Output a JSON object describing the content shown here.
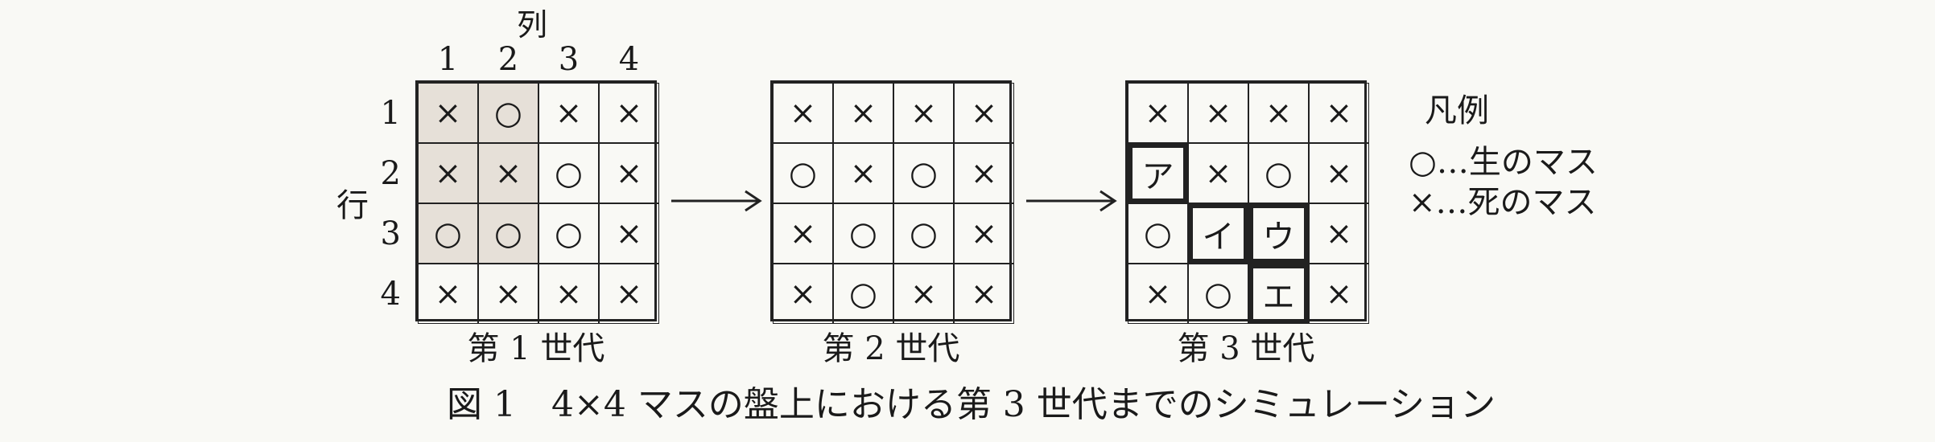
{
  "header": {
    "col_label": "列",
    "col_numbers": [
      "1",
      "2",
      "3",
      "4"
    ],
    "row_label": "行",
    "row_numbers": [
      "1",
      "2",
      "3",
      "4"
    ]
  },
  "generations": [
    {
      "caption": "第 1 世代",
      "cells": [
        [
          "×",
          "○",
          "×",
          "×"
        ],
        [
          "×",
          "×",
          "○",
          "×"
        ],
        [
          "○",
          "○",
          "○",
          "×"
        ],
        [
          "×",
          "×",
          "×",
          "×"
        ]
      ],
      "shaded": [
        [
          0,
          0
        ],
        [
          0,
          1
        ],
        [
          1,
          0
        ],
        [
          1,
          1
        ],
        [
          2,
          0
        ],
        [
          2,
          1
        ]
      ]
    },
    {
      "caption": "第 2 世代",
      "cells": [
        [
          "×",
          "×",
          "×",
          "×"
        ],
        [
          "○",
          "×",
          "○",
          "×"
        ],
        [
          "×",
          "○",
          "○",
          "×"
        ],
        [
          "×",
          "○",
          "×",
          "×"
        ]
      ]
    },
    {
      "caption": "第 3 世代",
      "cells": [
        [
          "×",
          "×",
          "×",
          "×"
        ],
        [
          "ア",
          "×",
          "○",
          "×"
        ],
        [
          "○",
          "イ",
          "ウ",
          "×"
        ],
        [
          "×",
          "○",
          "エ",
          "×"
        ]
      ],
      "bold": [
        [
          1,
          0
        ],
        [
          2,
          1
        ],
        [
          2,
          2
        ],
        [
          3,
          2
        ]
      ]
    }
  ],
  "legend": {
    "title": "凡例",
    "alive": "○…生のマス",
    "dead": "×…死のマス"
  },
  "figure_caption": "図 1　4×4 マスの盤上における第 3 世代までのシミュレーション"
}
